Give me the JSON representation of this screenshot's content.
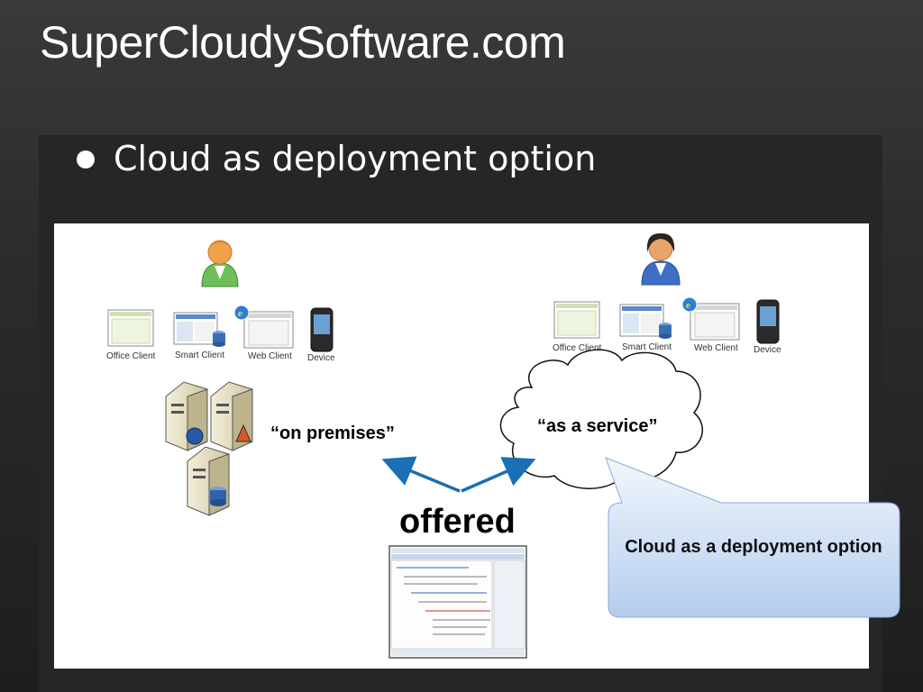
{
  "slide": {
    "title": "SuperCloudySoftware.com",
    "bullet": "Cloud as deployment option"
  },
  "diagram": {
    "left_group": {
      "clients": [
        "Office Client",
        "Smart Client",
        "Web Client",
        "Device"
      ],
      "label": "“on premises”"
    },
    "right_group": {
      "clients": [
        "Office Client",
        "Smart Client",
        "Web Client",
        "Device"
      ],
      "label": "“as a service”"
    },
    "center_label": "offered",
    "callout": "Cloud as a deployment option"
  },
  "colors": {
    "arrow": "#1a6fb5",
    "callout_top": "#f3f7fd",
    "callout_bottom": "#b4cdee"
  }
}
